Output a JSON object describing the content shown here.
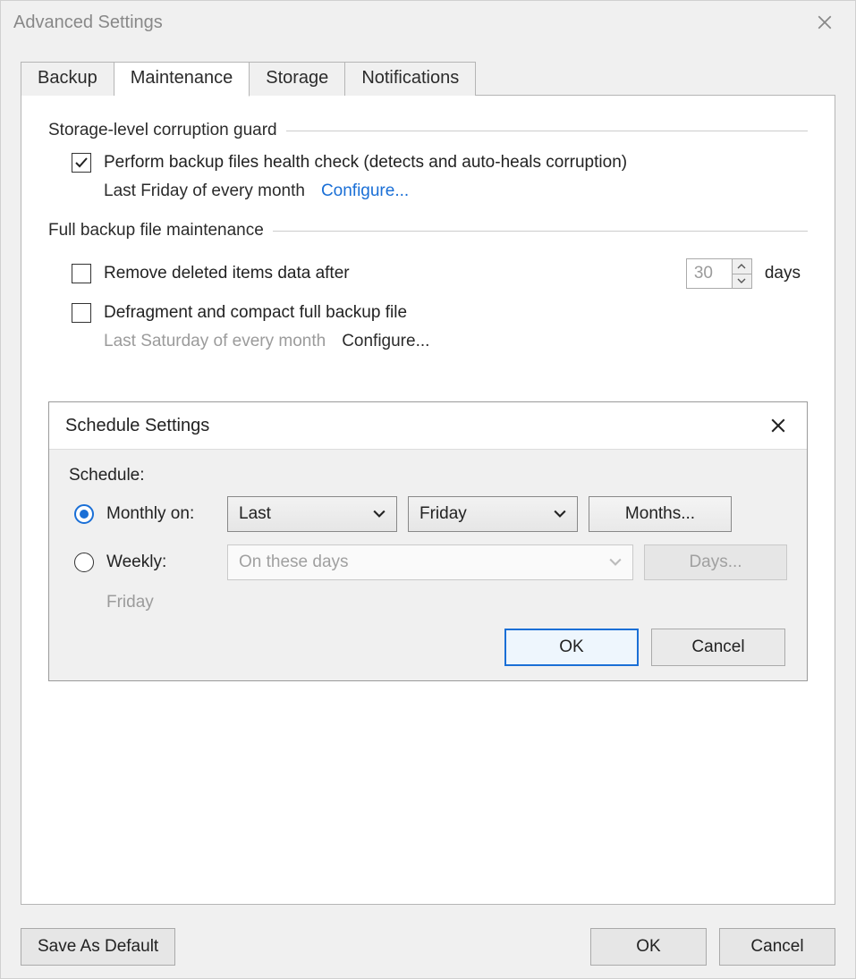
{
  "window": {
    "title": "Advanced Settings"
  },
  "tabs": {
    "backup": "Backup",
    "maintenance": "Maintenance",
    "storage": "Storage",
    "notifications": "Notifications"
  },
  "group1": {
    "title": "Storage-level corruption guard",
    "health_check_label": "Perform backup files health check (detects and auto-heals corruption)",
    "health_check_checked": true,
    "schedule_text": "Last Friday of every month",
    "configure_link": "Configure..."
  },
  "group2": {
    "title": "Full backup file maintenance",
    "remove_label": "Remove deleted items data after",
    "remove_checked": false,
    "remove_value": "30",
    "remove_suffix": "days",
    "defrag_label": "Defragment and compact full backup file",
    "defrag_checked": false,
    "defrag_schedule_text": "Last Saturday of every month",
    "defrag_configure_link": "Configure..."
  },
  "schedule_dialog": {
    "title": "Schedule Settings",
    "label": "Schedule:",
    "monthly_label": "Monthly on:",
    "monthly_selected": true,
    "monthly_occurrence": "Last",
    "monthly_day": "Friday",
    "months_btn": "Months...",
    "weekly_label": "Weekly:",
    "weekly_selected": false,
    "weekly_placeholder": "On these days",
    "days_btn": "Days...",
    "summary": "Friday",
    "ok": "OK",
    "cancel": "Cancel"
  },
  "footer": {
    "save_default": "Save As Default",
    "ok": "OK",
    "cancel": "Cancel"
  }
}
